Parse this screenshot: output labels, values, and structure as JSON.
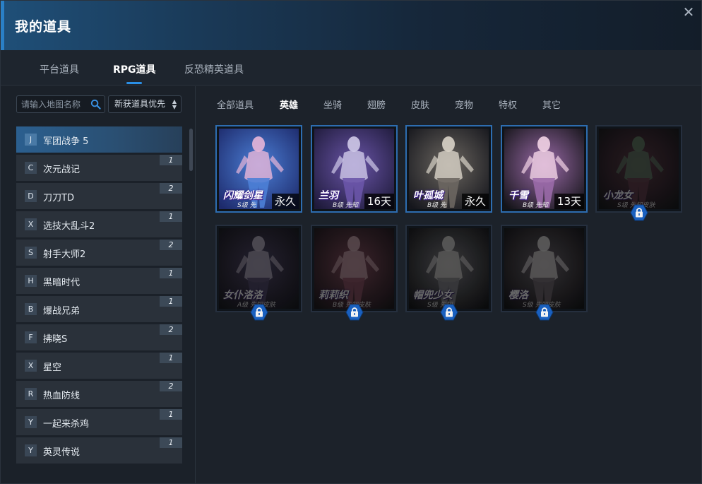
{
  "window": {
    "title": "我的道具",
    "close_glyph": "✕"
  },
  "main_tabs": [
    {
      "label": "平台道具",
      "active": false
    },
    {
      "label": "RPG道具",
      "active": true
    },
    {
      "label": "反恐精英道具",
      "active": false
    }
  ],
  "search": {
    "placeholder": "请输入地图名称",
    "value": ""
  },
  "sort": {
    "selected": "新获道具优先"
  },
  "maps": [
    {
      "letter": "J",
      "name": "军团战争 5",
      "count": "",
      "selected": true
    },
    {
      "letter": "C",
      "name": "次元战记",
      "count": "1"
    },
    {
      "letter": "D",
      "name": "刀刀TD",
      "count": "2"
    },
    {
      "letter": "X",
      "name": "选技大乱斗2",
      "count": "1"
    },
    {
      "letter": "S",
      "name": "射手大师2",
      "count": "2"
    },
    {
      "letter": "H",
      "name": "黑暗时代",
      "count": "1"
    },
    {
      "letter": "B",
      "name": "爆战兄弟",
      "count": "1"
    },
    {
      "letter": "F",
      "name": "拂晓S",
      "count": "2"
    },
    {
      "letter": "X",
      "name": "星空",
      "count": "1"
    },
    {
      "letter": "R",
      "name": "热血防线",
      "count": "2"
    },
    {
      "letter": "Y",
      "name": "一起来杀鸡",
      "count": "1"
    },
    {
      "letter": "Y",
      "name": "英灵传说",
      "count": "1"
    }
  ],
  "categories": [
    {
      "label": "全部道具",
      "active": false
    },
    {
      "label": "英雄",
      "active": true
    },
    {
      "label": "坐骑",
      "active": false
    },
    {
      "label": "翅膀",
      "active": false
    },
    {
      "label": "皮肤",
      "active": false
    },
    {
      "label": "宠物",
      "active": false
    },
    {
      "label": "特权",
      "active": false
    },
    {
      "label": "其它",
      "active": false
    }
  ],
  "heroes": [
    {
      "name": "闪耀剑星",
      "sub": "S级 先",
      "duration": "永久",
      "locked": false,
      "palette": [
        "#1d2a6b",
        "#4c7fd6",
        "#e8b6d8"
      ]
    },
    {
      "name": "兰羽",
      "sub": "B级 先知",
      "duration": "16天",
      "locked": false,
      "palette": [
        "#1e1a3a",
        "#6a55a8",
        "#cfc9e8"
      ]
    },
    {
      "name": "叶孤城",
      "sub": "B级 先",
      "duration": "永久",
      "locked": false,
      "palette": [
        "#15161c",
        "#6b6660",
        "#d9d3c8"
      ]
    },
    {
      "name": "千雪",
      "sub": "B级 先知",
      "duration": "13天",
      "locked": false,
      "palette": [
        "#141418",
        "#9a6aa8",
        "#f2d3e6"
      ]
    },
    {
      "name": "小龙女",
      "sub": "S级 先知皮肤",
      "duration": "",
      "locked": true,
      "palette": [
        "#1a1a1f",
        "#7a3b52",
        "#5a8a62"
      ]
    },
    {
      "name": "女仆洛洛",
      "sub": "A级 先知皮肤",
      "duration": "",
      "locked": true,
      "palette": [
        "#1b1b24",
        "#5a4a86",
        "#c8b8d8"
      ]
    },
    {
      "name": "莉莉织",
      "sub": "B级 先知皮肤",
      "duration": "",
      "locked": true,
      "palette": [
        "#231a20",
        "#b04a6a",
        "#e8a8b8"
      ]
    },
    {
      "name": "帽兜少女",
      "sub": "S级 先知",
      "duration": "",
      "locked": true,
      "palette": [
        "#18181c",
        "#8a8a92",
        "#e0dcd8"
      ]
    },
    {
      "name": "樱洛",
      "sub": "S级 先知皮肤",
      "duration": "",
      "locked": true,
      "palette": [
        "#18181c",
        "#7a6a78",
        "#e6e0e0"
      ]
    }
  ],
  "icons": {
    "search": "search-icon",
    "sort": "sort-arrows-icon",
    "lock": "lock-icon",
    "close": "close-icon"
  },
  "colors": {
    "accent": "#2a8fe6",
    "card_border": "#2d6db0",
    "lock_badge": "#1a64c8"
  }
}
